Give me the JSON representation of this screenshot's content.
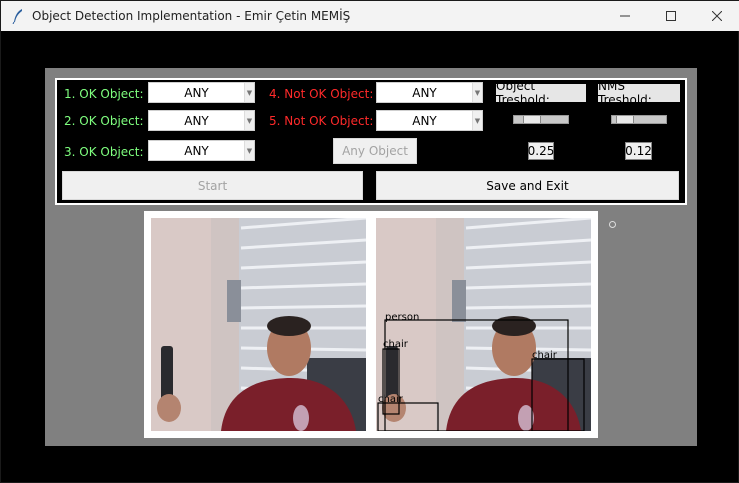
{
  "window": {
    "title": "Object Detection Implementation - Emir Çetin MEMİŞ",
    "minimize_icon": "minimize-icon",
    "maximize_icon": "maximize-icon",
    "close_icon": "close-icon"
  },
  "controls": {
    "ok_objects": [
      {
        "label": "1. OK Object:",
        "value": "ANY"
      },
      {
        "label": "2. OK Object:",
        "value": "ANY"
      },
      {
        "label": "3. OK Object:",
        "value": "ANY"
      }
    ],
    "not_ok_objects": [
      {
        "label": "4. Not OK Object:",
        "value": "ANY"
      },
      {
        "label": "5. Not OK Object:",
        "value": "ANY"
      }
    ],
    "any_object_button": "Any Object",
    "object_threshold": {
      "label": "Object Treshold:",
      "value": "0.25",
      "slider_level": 0.25
    },
    "nms_threshold": {
      "label": "NMS Treshold:",
      "value": "0.12",
      "slider_level": 0.12
    },
    "start_button": "Start",
    "save_exit_button": "Save and Exit"
  },
  "preview": {
    "detections": [
      "person",
      "chair",
      "chair",
      "chair"
    ]
  },
  "colors": {
    "ok_label": "#7fff7f",
    "not_ok_label": "#ff2a2a",
    "panel_bg": "#000000",
    "outer_bg": "#808080"
  }
}
